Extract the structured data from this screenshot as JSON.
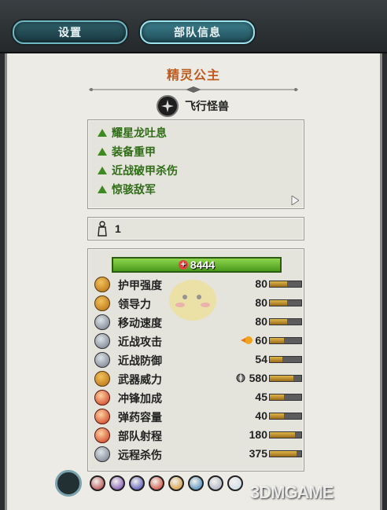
{
  "tabs": [
    {
      "label": "设置",
      "active": false
    },
    {
      "label": "部队信息",
      "active": true
    }
  ],
  "unit": {
    "name": "精灵公主",
    "type_label": "飞行怪兽"
  },
  "abilities": [
    {
      "label": "耀星龙吐息",
      "color": "#2f6d17"
    },
    {
      "label": "装备重甲",
      "color": "#2f6d17"
    },
    {
      "label": "近战破甲杀伤",
      "color": "#2f6d17"
    },
    {
      "label": "惊骇敌军",
      "color": "#2f6d17"
    }
  ],
  "unit_count": "1",
  "hp": "8444",
  "stats": [
    {
      "label": "护甲强度",
      "value": "80",
      "fill": 0.55,
      "icon": "armor-icon"
    },
    {
      "label": "领导力",
      "value": "80",
      "fill": 0.55,
      "icon": "leadership-icon"
    },
    {
      "label": "移动速度",
      "value": "80",
      "fill": 0.55,
      "icon": "speed-icon"
    },
    {
      "label": "近战攻击",
      "value": "60",
      "fill": 0.45,
      "icon": "melee-attack-icon",
      "modifier": "fire-icon"
    },
    {
      "label": "近战防御",
      "value": "54",
      "fill": 0.4,
      "icon": "melee-defence-icon"
    },
    {
      "label": "武器威力",
      "value": "580",
      "fill": 0.75,
      "icon": "weapon-strength-icon",
      "modifier": "armour-piercing-icon"
    },
    {
      "label": "冲锋加成",
      "value": "45",
      "fill": 0.45,
      "icon": "charge-bonus-icon"
    },
    {
      "label": "弹药容量",
      "value": "40",
      "fill": 0.45,
      "icon": "ammunition-icon"
    },
    {
      "label": "部队射程",
      "value": "180",
      "fill": 0.8,
      "icon": "range-icon"
    },
    {
      "label": "远程杀伤",
      "value": "375",
      "fill": 0.85,
      "icon": "missile-damage-icon"
    }
  ],
  "bottom_icons": [
    "unit-portrait-icon",
    "frenzy-icon",
    "terror-icon",
    "fear-icon",
    "strength-icon",
    "flying-icon",
    "breath-icon",
    "armour-icon",
    "magic-icon"
  ],
  "colors": {
    "accent": "#6fb9c4",
    "title": "#c05a1c",
    "ability": "#2f6d17",
    "hp": "#5bb02a"
  },
  "watermark": "3DMGAME"
}
